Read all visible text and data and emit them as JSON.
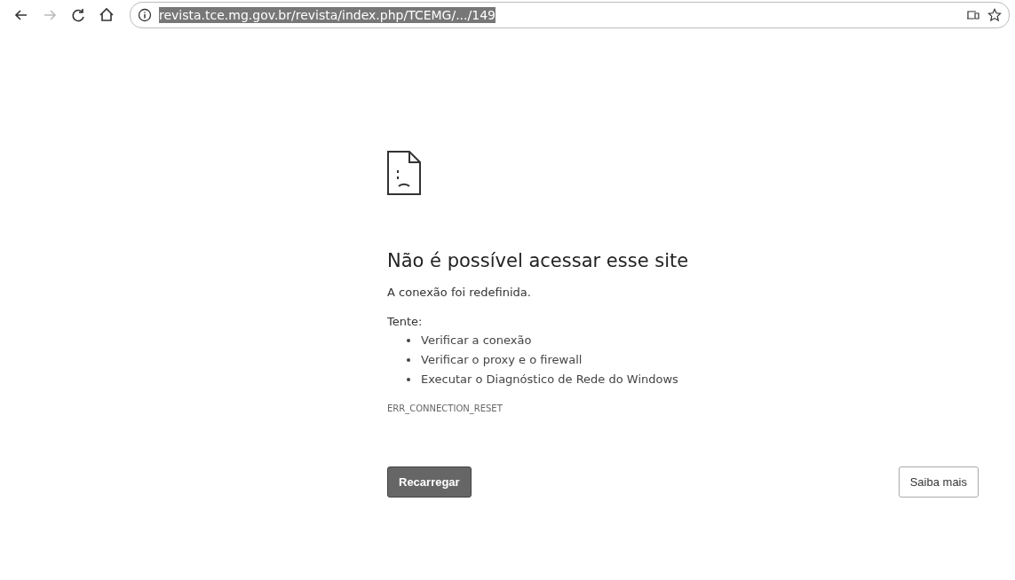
{
  "toolbar": {
    "back": {
      "disabled": false
    },
    "forward": {
      "disabled": true
    },
    "url": {
      "text": "revista.tce.mg.gov.br/revista/index.php/TCEMG/.../149",
      "selected": true
    }
  },
  "error": {
    "title": "Não é possível acessar esse site",
    "message": "A conexão foi redefinida.",
    "suggestions_label": "Tente:",
    "suggestions": [
      "Verificar a conexão",
      "Verificar o proxy e o firewall",
      "Executar o Diagnóstico de Rede do Windows"
    ],
    "code": "ERR_CONNECTION_RESET"
  },
  "buttons": {
    "primary": "Recarregar",
    "secondary": "Saiba mais"
  }
}
